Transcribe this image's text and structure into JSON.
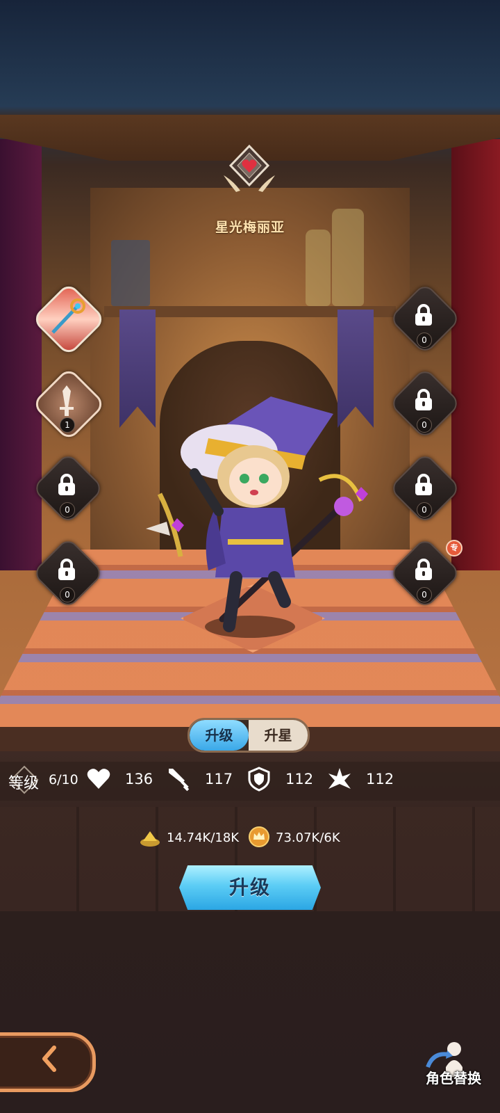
{
  "hero": {
    "name": "星光梅丽亚"
  },
  "left_slots": [
    {
      "type": "weapon",
      "count": ""
    },
    {
      "type": "skill",
      "count": "1"
    },
    {
      "type": "locked",
      "count": "0"
    },
    {
      "type": "locked",
      "count": "0"
    }
  ],
  "right_slots": [
    {
      "type": "locked",
      "count": "0"
    },
    {
      "type": "locked",
      "count": "0"
    },
    {
      "type": "locked",
      "count": "0"
    },
    {
      "type": "locked",
      "count": "0",
      "badge": "专"
    }
  ],
  "tabs": {
    "upgrade": "升级",
    "star": "升星",
    "active": "upgrade"
  },
  "stats": {
    "level_label": "等级",
    "level_value": "6/10",
    "hp": "136",
    "attack": "117",
    "defense": "112",
    "crit": "112"
  },
  "costs": [
    {
      "icon": "gold-pile-icon",
      "value": "14.74K/18K"
    },
    {
      "icon": "crown-coin-icon",
      "value": "73.07K/6K"
    }
  ],
  "upgrade_button": "升级",
  "swap_label": "角色替换",
  "colors": {
    "accent_blue": "#3aa8e8",
    "back_border": "#e89a60",
    "name_gold": "#ffe3b0"
  }
}
